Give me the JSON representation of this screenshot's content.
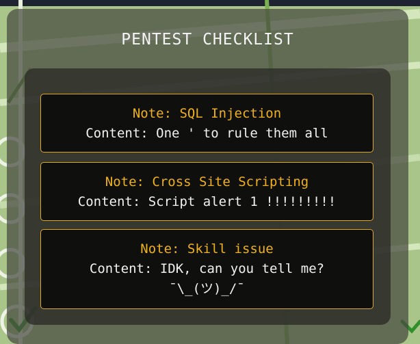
{
  "page": {
    "title": "PENTEST CHECKLIST"
  },
  "notes": [
    {
      "title": "Note: SQL Injection",
      "content": "Content: One ' to rule them all"
    },
    {
      "title": "Note: Cross Site Scripting",
      "content": "Content: Script alert 1 !!!!!!!!!"
    },
    {
      "title": "Note: Skill issue",
      "content": "Content: IDK, can you tell me?",
      "extra": "¯\\_(ツ)_/¯"
    }
  ],
  "colors": {
    "background": "#a9c58a",
    "note_border": "#e0a82a",
    "note_title": "#f0b21c",
    "note_text": "#f2f2f2"
  },
  "icons": [
    "checkmark-icon",
    "empty-circle-icon"
  ]
}
